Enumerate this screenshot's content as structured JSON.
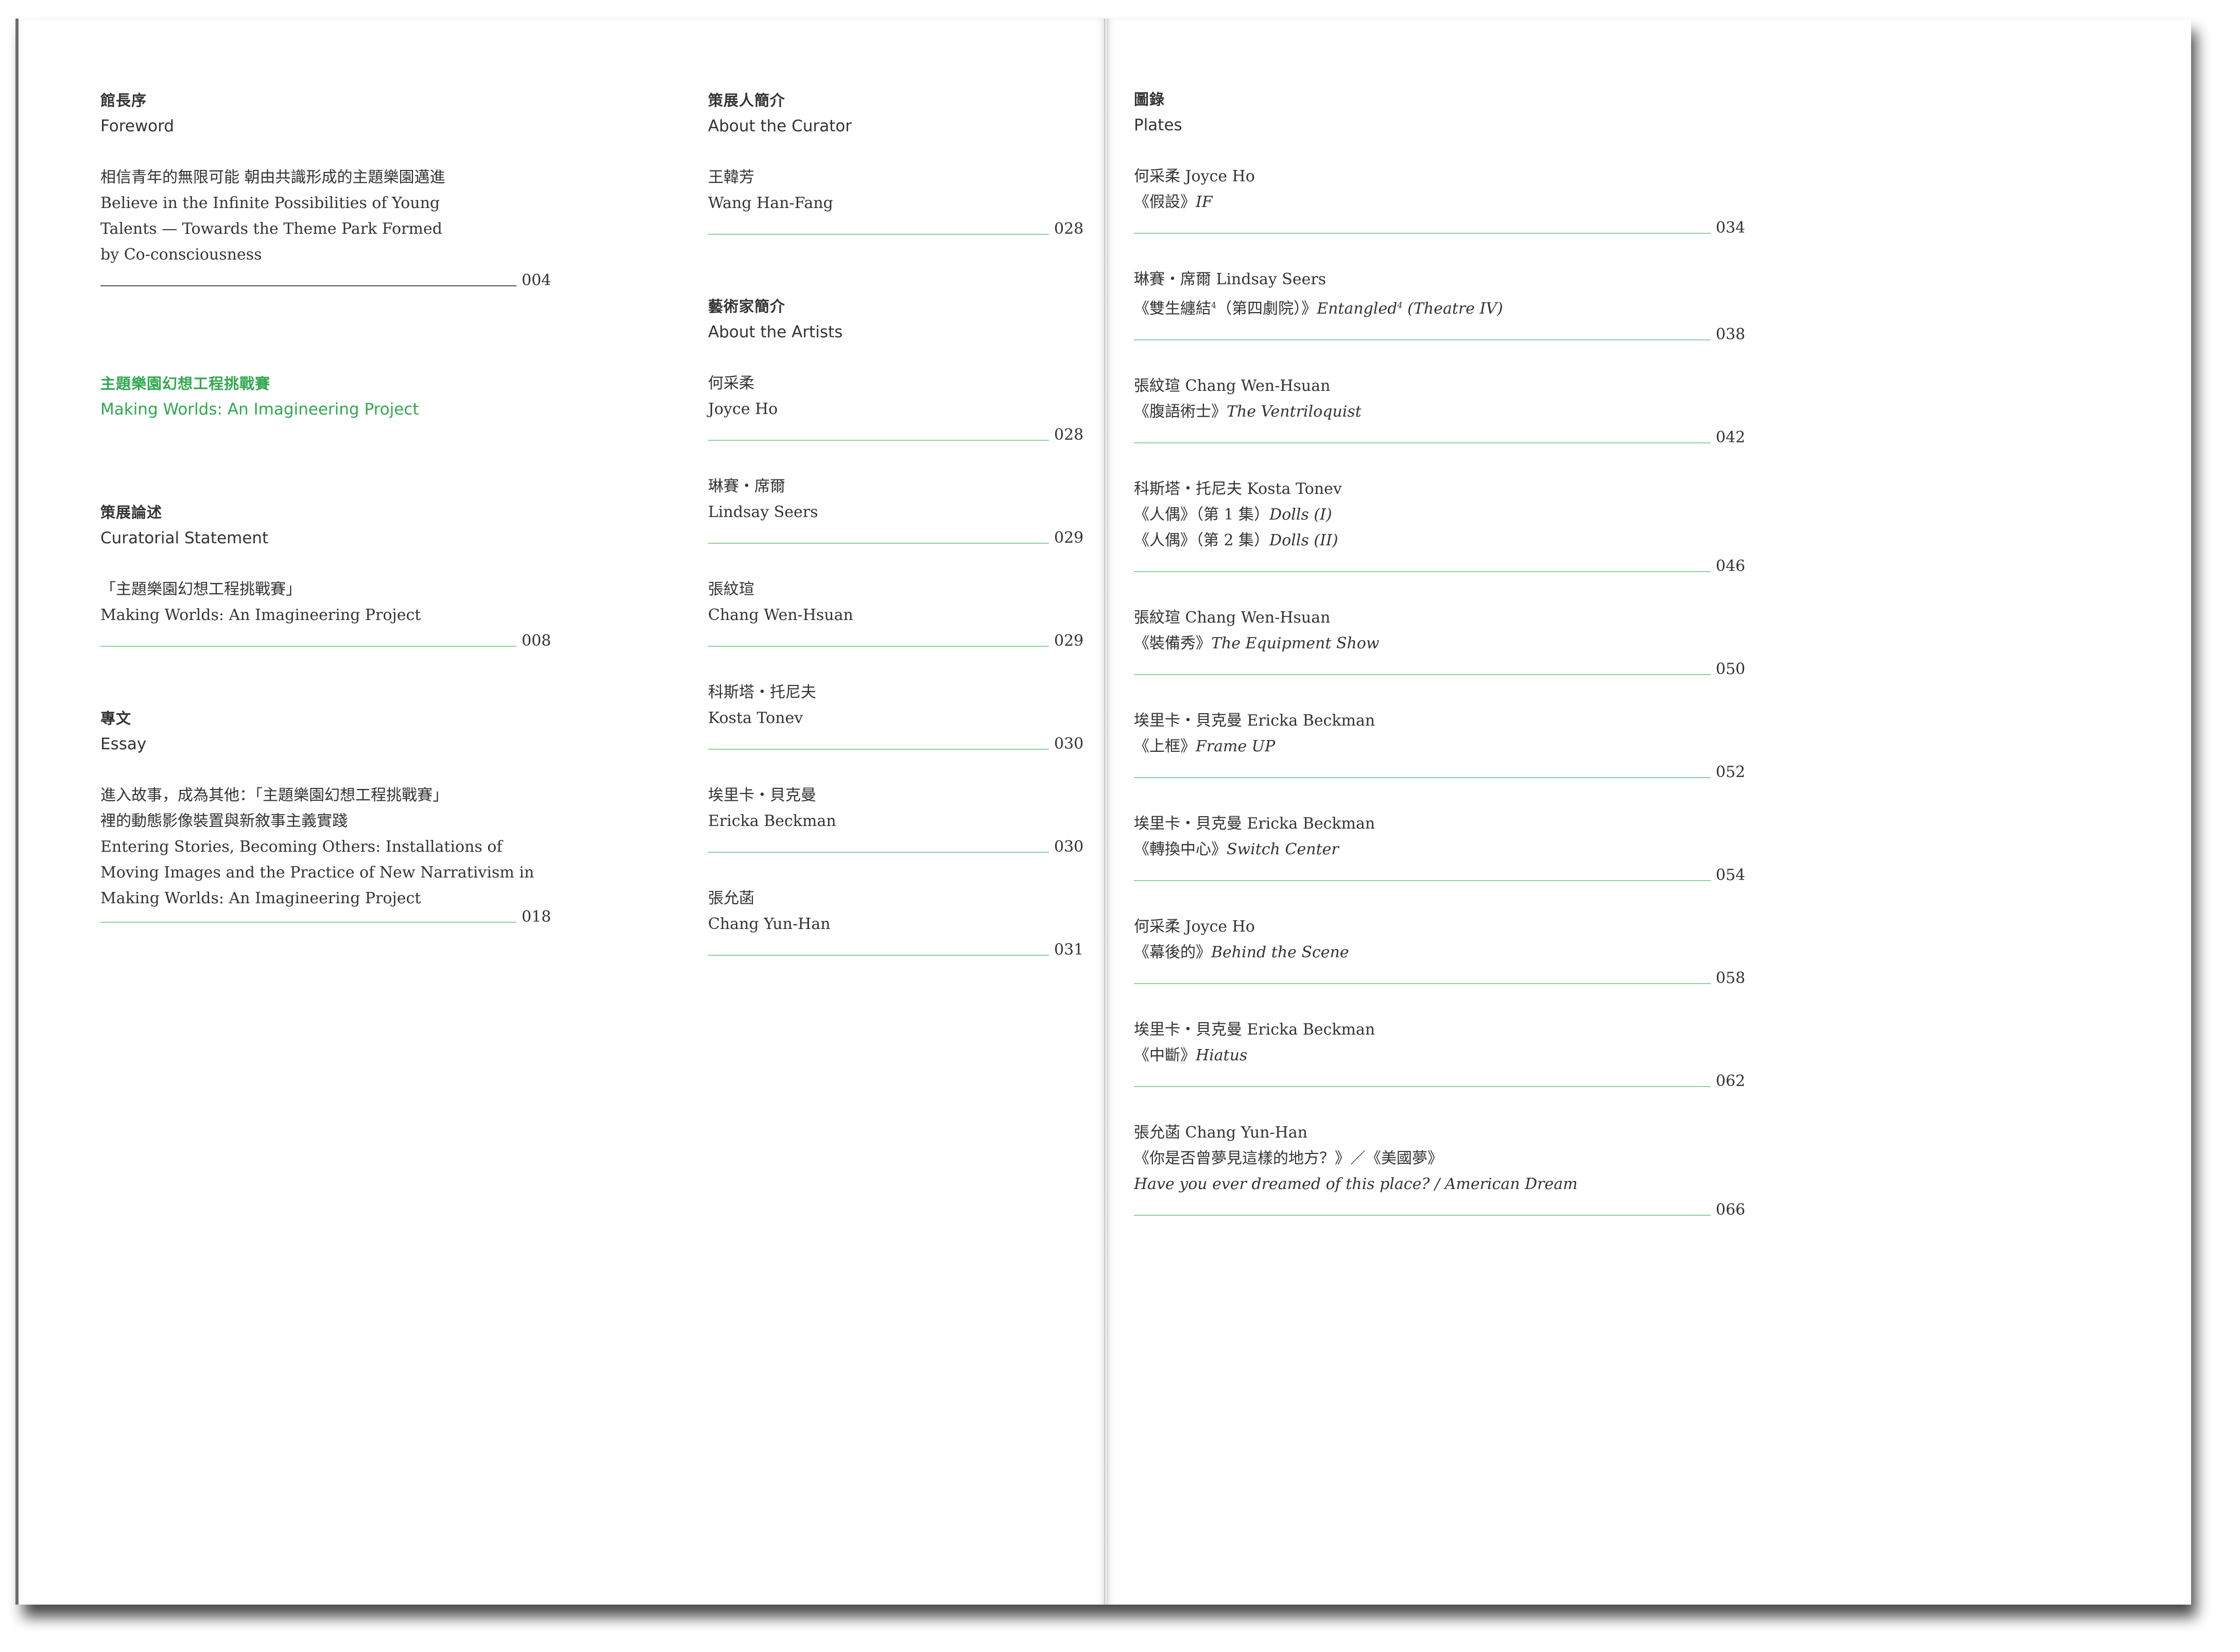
{
  "col1": {
    "foreword": {
      "zh": "館長序",
      "en": "Foreword",
      "lines": [
        "相信青年的無限可能 朝由共識形成的主題樂園邁進",
        "Believe in the Infinite Possibilities of Young",
        "Talents — Towards the Theme Park Formed",
        "by Co-consciousness"
      ],
      "page": "004"
    },
    "project": {
      "zh": "主題樂園幻想工程挑戰賽",
      "en": "Making Worlds: An Imagineering Project"
    },
    "curatorial": {
      "zh": "策展論述",
      "en": "Curatorial Statement",
      "lines": [
        "「主題樂園幻想工程挑戰賽」",
        "Making Worlds: An Imagineering Project"
      ],
      "page": "008"
    },
    "essay": {
      "zh": "專文",
      "en": "Essay",
      "lines": [
        "進入故事，成為其他：「主題樂園幻想工程挑戰賽」",
        "裡的動態影像裝置與新敘事主義實踐",
        "Entering Stories, Becoming Others: Installations of",
        "Moving Images and the Practice of New Narrativism in",
        "Making Worlds: An Imagineering Project"
      ],
      "page": "018"
    }
  },
  "col2": {
    "curator": {
      "zh": "策展人簡介",
      "en": "About the Curator",
      "name_zh": "王韓芳",
      "name_en": "Wang Han-Fang",
      "page": "028"
    },
    "artists_head": {
      "zh": "藝術家簡介",
      "en": "About the Artists"
    },
    "artists": [
      {
        "zh": "何采柔",
        "en": "Joyce Ho",
        "page": "028"
      },
      {
        "zh": "琳賽・席爾",
        "en": "Lindsay Seers",
        "page": "029"
      },
      {
        "zh": "張紋瑄",
        "en": "Chang Wen-Hsuan",
        "page": "029"
      },
      {
        "zh": "科斯塔・托尼夫",
        "en": "Kosta Tonev",
        "page": "030"
      },
      {
        "zh": "埃里卡・貝克曼",
        "en": "Ericka Beckman",
        "page": "030"
      },
      {
        "zh": "張允菡",
        "en": "Chang Yun-Han",
        "page": "031"
      }
    ]
  },
  "col3": {
    "zh": "圖錄",
    "en": "Plates",
    "plates": [
      {
        "artist": "何采柔 Joyce Ho",
        "title_zh": "《假設》",
        "title_en": "IF",
        "page": "034"
      },
      {
        "artist": "琳賽・席爾 Lindsay Seers",
        "title_zh": "《雙生纏結",
        "sup1": "4",
        "title_zh2": "（第四劇院）》",
        "title_en": "Entangled",
        "sup2": "4",
        "title_en2": " (Theatre IV)",
        "page": "038"
      },
      {
        "artist": "張紋瑄 Chang Wen-Hsuan",
        "title_zh": "《腹語術士》",
        "title_en": "The Ventriloquist",
        "page": "042"
      },
      {
        "artist": "科斯塔・托尼夫 Kosta Tonev",
        "title_zh": "《人偶》（第 1 集）",
        "title_en": "Dolls (I)",
        "title_zh_b": "《人偶》（第 2 集）",
        "title_en_b": "Dolls (II)",
        "page": "046"
      },
      {
        "artist": "張紋瑄 Chang Wen-Hsuan",
        "title_zh": "《裝備秀》",
        "title_en": "The Equipment Show",
        "page": "050"
      },
      {
        "artist": "埃里卡・貝克曼 Ericka Beckman",
        "title_zh": "《上框》",
        "title_en": "Frame UP",
        "page": "052"
      },
      {
        "artist": "埃里卡・貝克曼 Ericka Beckman",
        "title_zh": "《轉換中心》",
        "title_en": "Switch Center",
        "page": "054"
      },
      {
        "artist": "何采柔 Joyce Ho",
        "title_zh": "《幕後的》",
        "title_en": "Behind the Scene",
        "page": "058"
      },
      {
        "artist": "埃里卡・貝克曼 Ericka Beckman",
        "title_zh": "《中斷》",
        "title_en": "Hiatus",
        "page": "062"
      },
      {
        "artist": "張允菡 Chang Yun-Han",
        "title_zh": "《你是否曾夢見這樣的地方？》／《美國夢》",
        "title_en": "Have you ever dreamed of this place? / American Dream",
        "page": "066"
      }
    ]
  },
  "colors": {
    "accent_green": "#2fa84f",
    "rule_green": "#8fd19e",
    "text": "#333333"
  }
}
